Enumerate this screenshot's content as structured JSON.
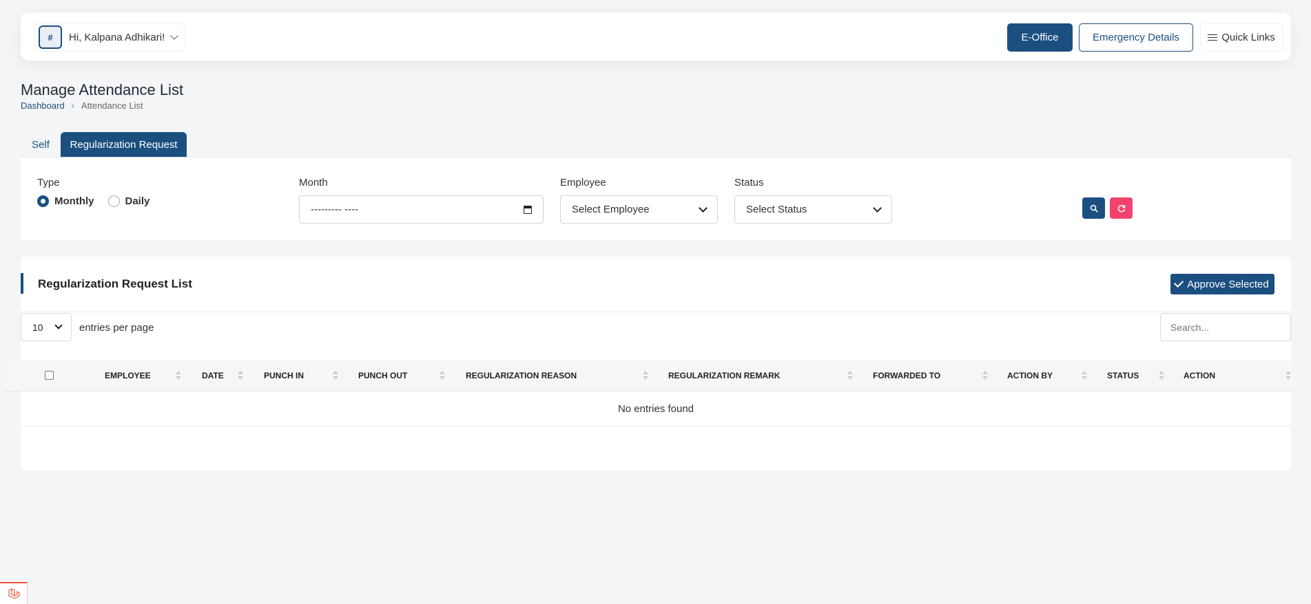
{
  "header": {
    "greeting": "Hi, Kalpana Adhikari!",
    "avatar_alt": "#",
    "eoffice_label": "E-Office",
    "emergency_label": "Emergency Details",
    "quick_links_label": "Quick Links"
  },
  "page": {
    "title": "Manage Attendance List",
    "breadcrumb": [
      "Dashboard",
      "Attendance List"
    ]
  },
  "tabs": [
    {
      "label": "Self",
      "active": false
    },
    {
      "label": "Regularization Request",
      "active": true
    }
  ],
  "filters": {
    "type_label": "Type",
    "type_options": [
      "Monthly",
      "Daily"
    ],
    "type_selected": "Monthly",
    "month_label": "Month",
    "month_value": "--------- ----",
    "employee_label": "Employee",
    "employee_value": "Select Employee",
    "status_label": "Status",
    "status_value": "Select Status"
  },
  "list": {
    "title": "Regularization Request List",
    "approve_label": "Approve Selected",
    "entries_value": "10",
    "entries_label": "entries per page",
    "search_placeholder": "Search...",
    "columns": [
      "EMPLOYEE",
      "DATE",
      "PUNCH IN",
      "PUNCH OUT",
      "REGULARIZATION REASON",
      "REGULARIZATION REMARK",
      "FORWARDED TO",
      "ACTION BY",
      "STATUS",
      "ACTION"
    ],
    "empty_text": "No entries found"
  },
  "colors": {
    "primary": "#1b4f80",
    "danger": "#f2426d",
    "background": "#f4f5f7"
  }
}
